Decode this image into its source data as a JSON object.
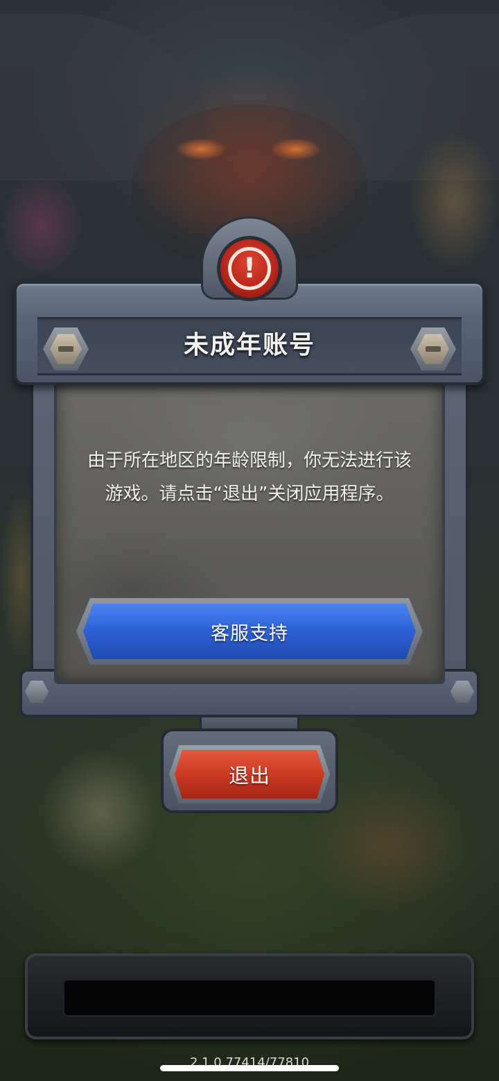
{
  "dialog": {
    "title": "未成年账号",
    "message": "由于所在地区的年龄限制，你无法进行该游戏。请点击“退出”关闭应用程序。",
    "alert_icon": "exclamation-icon",
    "alert_glyph": "!",
    "support_label": "客服支持",
    "exit_label": "退出"
  },
  "footer": {
    "version": "2.1.0.77414/77810"
  },
  "colors": {
    "support_button": "#2f63d6",
    "exit_button": "#cc3a25",
    "alert": "#b3251a"
  }
}
